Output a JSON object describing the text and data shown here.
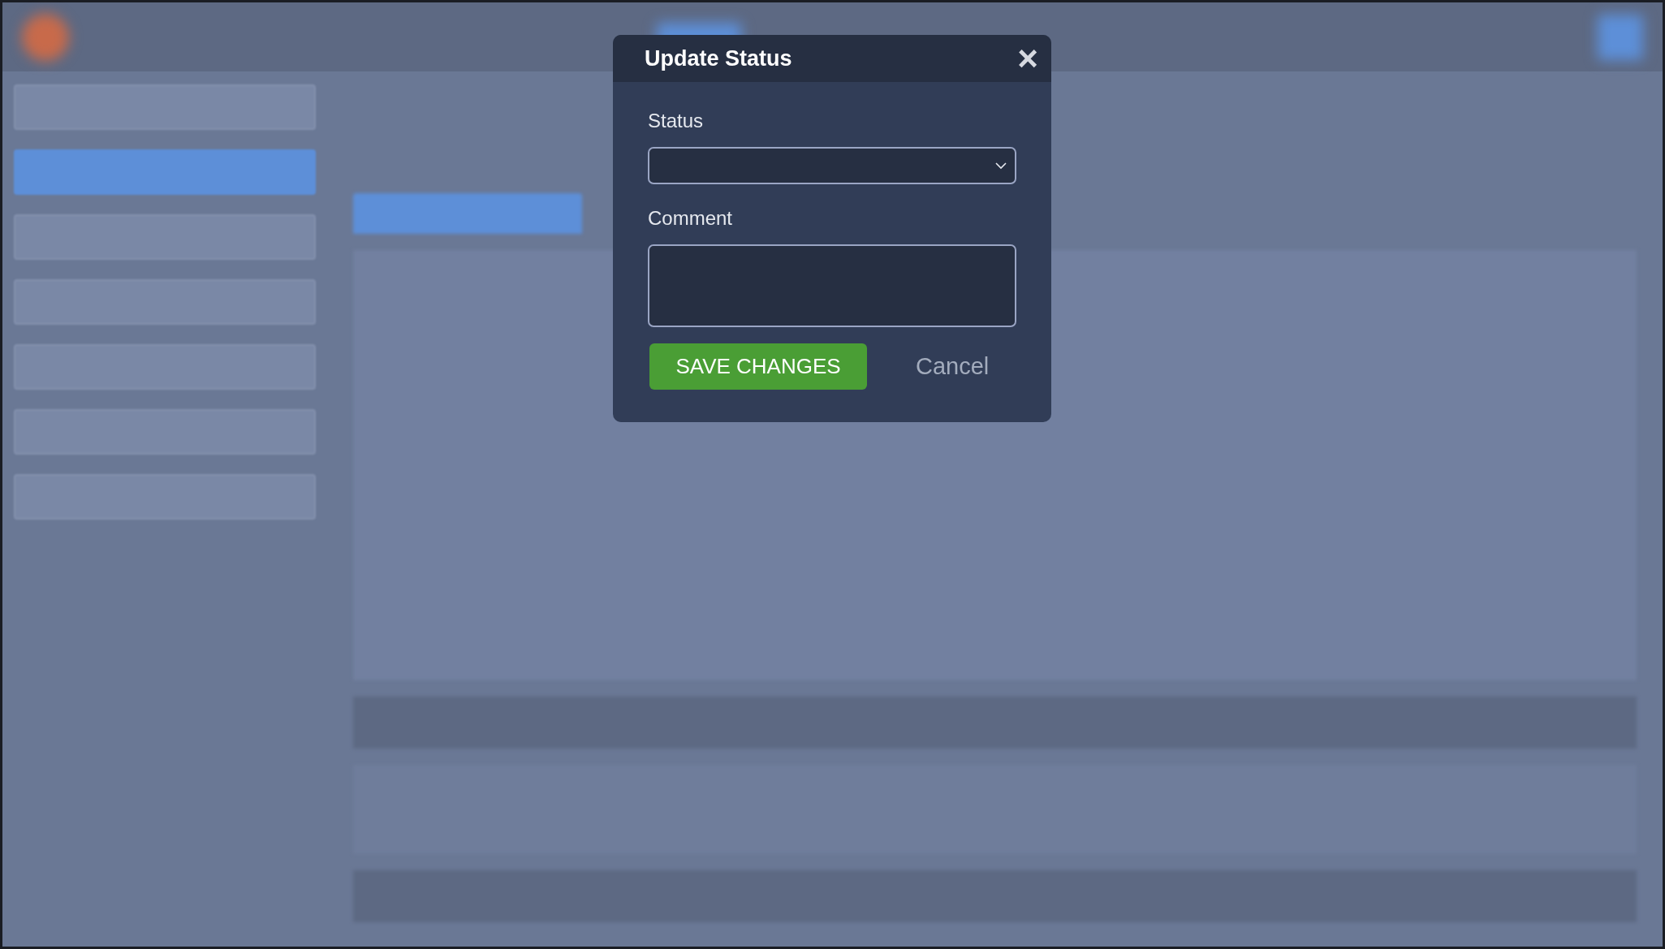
{
  "dialog": {
    "title": "Update Status",
    "close": "×",
    "fields": [
      {
        "kind": "select",
        "label": "Status"
      },
      {
        "kind": "textarea",
        "label": "Comment"
      }
    ],
    "buttons": [
      {
        "kind": "primary",
        "label": "SAVE CHANGES"
      },
      {
        "kind": "link",
        "label": "Cancel"
      }
    ]
  }
}
